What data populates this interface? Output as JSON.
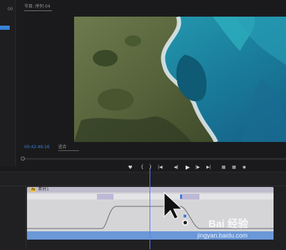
{
  "left_panel": {
    "tab_partial": "00",
    "item_selected": ""
  },
  "monitor": {
    "title": "节目: 序列 04",
    "timecode": "00:42:49:16",
    "fit_label": "适合",
    "video_image": "aerial coastline: green scrubland cliffs meeting turquoise sea"
  },
  "transport": {
    "icons": [
      "marker-icon",
      "mark-in-icon",
      "mark-out-icon",
      "go-to-in-icon",
      "step-back-icon",
      "play-icon",
      "step-forward-icon",
      "go-to-out-icon",
      "lift-icon",
      "extract-icon",
      "export-frame-icon"
    ]
  },
  "timeline": {
    "clip_fx_badge": "fx",
    "clip_name": "素材1"
  },
  "watermark": {
    "brand": "Bai 经验",
    "url": "jingyan.baidu.com"
  },
  "colors": {
    "background": "#1a1a1c",
    "accent_blue": "#3a82d6",
    "playhead": "#4f7fff",
    "clip_fill": "#d5d5d8",
    "clip_header": "#c0bccc",
    "fx_badge": "#f0c540"
  }
}
